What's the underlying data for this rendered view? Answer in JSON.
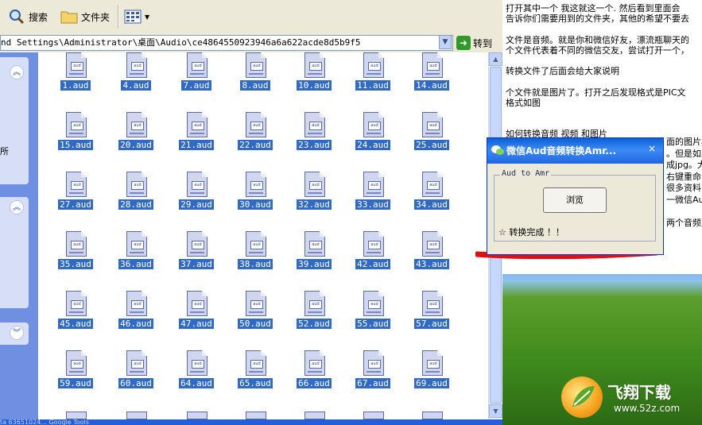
{
  "toolbar": {
    "search_label": "搜索",
    "folders_label": "文件夹"
  },
  "address": {
    "path": "nd Settings\\Administrator\\桌面\\Audio\\ce4864550923946a6a622acde8d5b9f5",
    "go_label": "转到"
  },
  "files": [
    "1.aud",
    "4.aud",
    "7.aud",
    "8.aud",
    "10.aud",
    "11.aud",
    "14.aud",
    "15.aud",
    "20.aud",
    "21.aud",
    "22.aud",
    "23.aud",
    "24.aud",
    "25.aud",
    "27.aud",
    "28.aud",
    "29.aud",
    "30.aud",
    "32.aud",
    "33.aud",
    "34.aud",
    "35.aud",
    "36.aud",
    "37.aud",
    "38.aud",
    "39.aud",
    "42.aud",
    "43.aud",
    "45.aud",
    "46.aud",
    "47.aud",
    "50.aud",
    "52.aud",
    "55.aud",
    "57.aud",
    "59.aud",
    "60.aud",
    "64.aud",
    "65.aud",
    "66.aud",
    "67.aud",
    "69.aud"
  ],
  "leftpane": {
    "fragment": "所"
  },
  "document": {
    "lines": [
      "打开其中一个 我这就这一个.  然后看到里面会",
      "告诉你们需要用到的文件夹，其他的希望不要去",
      "",
      "文件是音频。就是你和微信好友，漂流瓶聊天的",
      "个文件代表着不同的微信交友，尝试打开一个，",
      "",
      "转换文件了后面会给大家说明",
      "",
      "个文件就是图片了。打开之后发现格式是PIC文",
      "格式如图",
      "",
      "",
      "如何转换音频 视频 和图片"
    ],
    "partial_right": [
      "面的图片格",
      "。但是如果",
      "成jpg。大",
      "右键重命",
      "很多资料",
      "一微信Aud",
      "",
      "两个音频文"
    ]
  },
  "dialog": {
    "title": "微信Aud音频转换Amr...",
    "close": "×",
    "legend": "Aud to Amr",
    "browse_label": "浏览",
    "status": "☆ 转换完成 ！！"
  },
  "taskbar": {
    "text": "ta  63651024...       Google        Tools"
  },
  "watermark": {
    "brand": "飞翔下载",
    "url": "www.52z.com"
  },
  "colors": {
    "selection": "#316ac5",
    "xp_blue": "#0a5fd8",
    "toolbar": "#ece9d8",
    "red_mark": "#e01010"
  }
}
